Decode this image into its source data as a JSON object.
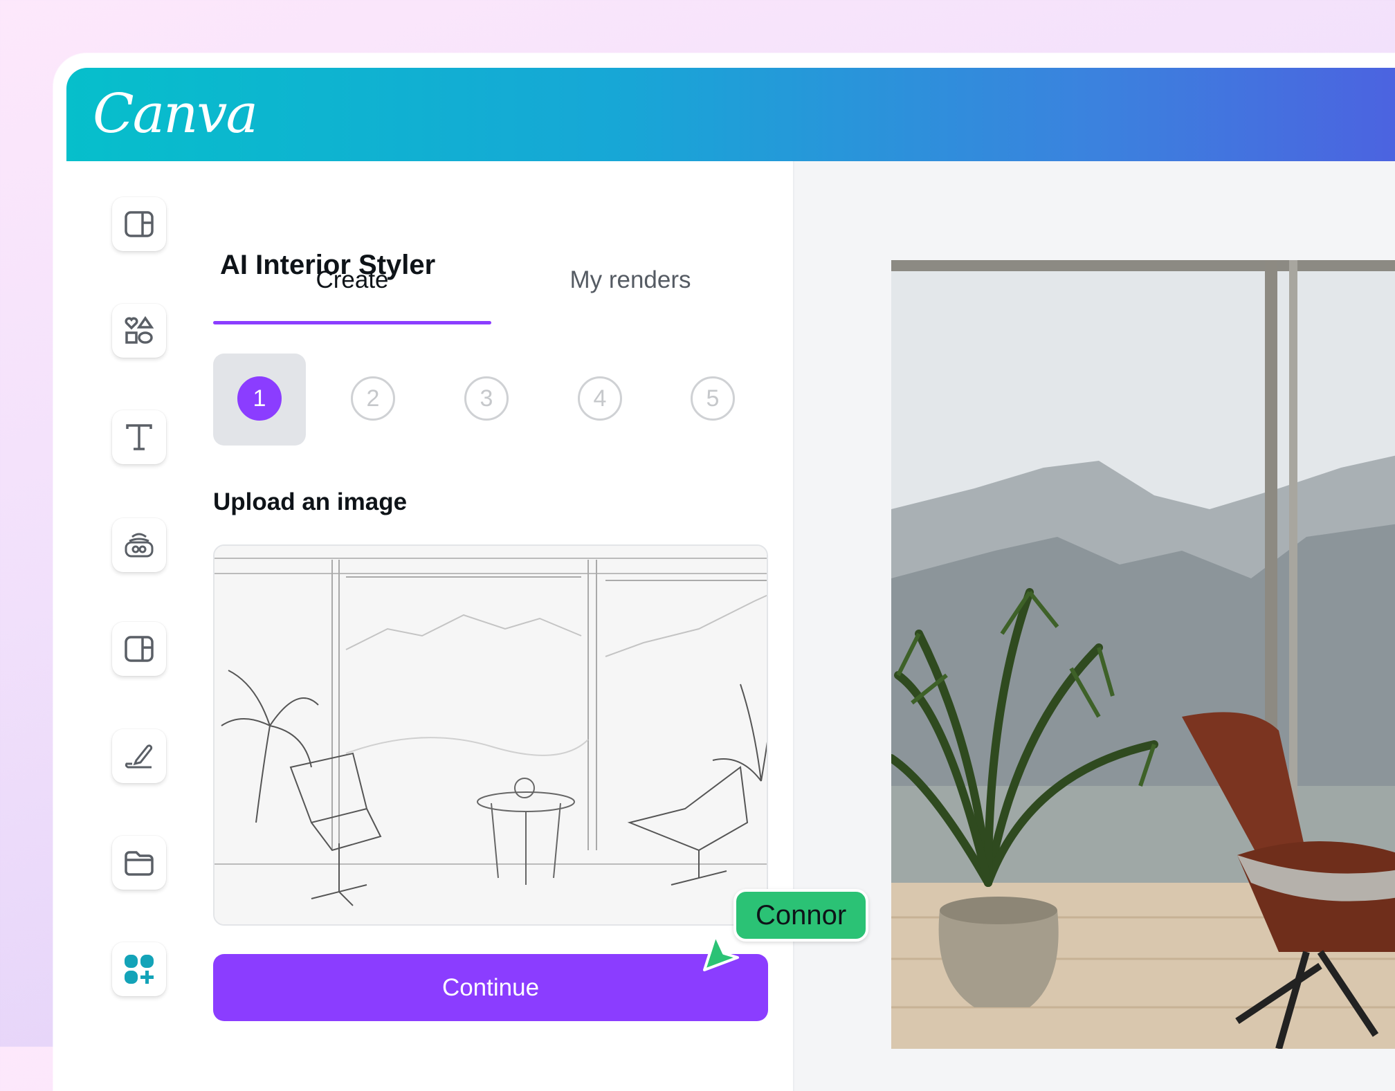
{
  "app": {
    "logo": "Canva"
  },
  "sidebar": {
    "items": [
      {
        "name": "design",
        "icon": "layout-icon"
      },
      {
        "name": "elements",
        "icon": "shapes-icon"
      },
      {
        "name": "text",
        "icon": "text-icon"
      },
      {
        "name": "brand",
        "icon": "brand-icon"
      },
      {
        "name": "templates",
        "icon": "layout-icon"
      },
      {
        "name": "draw",
        "icon": "draw-icon"
      },
      {
        "name": "projects",
        "icon": "folder-icon"
      },
      {
        "name": "apps",
        "icon": "apps-icon"
      }
    ]
  },
  "panel": {
    "title": "AI Interior Styler",
    "tabs": [
      {
        "label": "Create",
        "active": true
      },
      {
        "label": "My renders",
        "active": false
      }
    ],
    "steps": [
      "1",
      "2",
      "3",
      "4",
      "5"
    ],
    "active_step": 1,
    "upload_label": "Upload an image",
    "continue_label": "Continue"
  },
  "collaborator": {
    "name": "Connor",
    "color": "#2bc275"
  },
  "colors": {
    "accent": "#8b3dff",
    "teal": "#13a3b8"
  }
}
